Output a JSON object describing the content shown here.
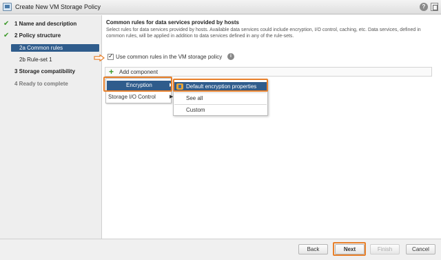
{
  "window": {
    "title": "Create New VM Storage Policy",
    "help_label": "?"
  },
  "steps": [
    {
      "label": "1  Name and description",
      "done": true
    },
    {
      "label": "2  Policy structure",
      "done": true
    },
    {
      "label": "2a  Common rules",
      "active": true
    },
    {
      "label": "2b  Rule-set 1"
    },
    {
      "label": "3  Storage compatibility"
    },
    {
      "label": "4  Ready to complete"
    }
  ],
  "content": {
    "heading": "Common rules for data services provided by hosts",
    "description": "Select rules for data services provided by hosts. Available data services could include encryption, I/O control, caching, etc. Data services, defined in common rules, will be applied in addition to data services defined in any of the rule-sets.",
    "use_common_rules_label": "Use common rules in the VM storage policy",
    "use_common_rules_checked": true,
    "info_icon": "i",
    "add_component_label": "Add component"
  },
  "component_menu": {
    "items": [
      {
        "label": "Encryption",
        "highlighted": true
      },
      {
        "label": "Storage I/O Control"
      }
    ]
  },
  "encryption_submenu": {
    "items": [
      {
        "label": "Default encryption properties",
        "highlighted": true
      },
      {
        "label": "See all"
      },
      {
        "label": "Custom"
      }
    ]
  },
  "footer": {
    "back_label": "Back",
    "next_label": "Next",
    "finish_label": "Finish",
    "cancel_label": "Cancel"
  },
  "colors": {
    "accent": "#2f5c8c",
    "callout": "#e8802a",
    "check": "#3c9a2a"
  }
}
